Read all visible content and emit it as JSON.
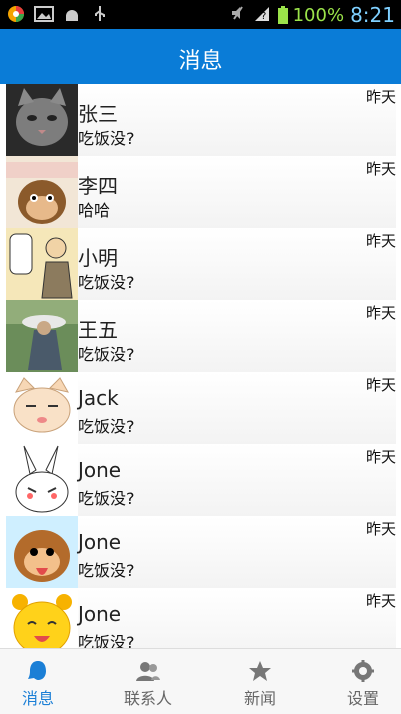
{
  "status": {
    "battery_text": "100%",
    "time": "8:21"
  },
  "header": {
    "title": "消息"
  },
  "messages": [
    {
      "name": "张三",
      "preview": "吃饭没?",
      "time": "昨天",
      "avatar": "cat-photo"
    },
    {
      "name": "李四",
      "preview": "哈哈",
      "time": "昨天",
      "avatar": "monkey-cartoon"
    },
    {
      "name": "小明",
      "preview": "吃饭没?",
      "time": "昨天",
      "avatar": "comic-character"
    },
    {
      "name": "王五",
      "preview": "吃饭没?",
      "time": "昨天",
      "avatar": "person-photo"
    },
    {
      "name": "Jack",
      "preview": "吃饭没?",
      "time": "昨天",
      "avatar": "cat-cartoon"
    },
    {
      "name": "Jone",
      "preview": "吃饭没?",
      "time": "昨天",
      "avatar": "rabbit-cartoon"
    },
    {
      "name": "Jone",
      "preview": "吃饭没?",
      "time": "昨天",
      "avatar": "monkey-tongue-cartoon"
    },
    {
      "name": "Jone",
      "preview": "吃饭没?",
      "time": "昨天",
      "avatar": "yellow-bear-cartoon"
    }
  ],
  "tabs": [
    {
      "label": "消息",
      "icon": "chat-icon",
      "active": true
    },
    {
      "label": "联系人",
      "icon": "contacts-icon",
      "active": false
    },
    {
      "label": "新闻",
      "icon": "news-icon",
      "active": false
    },
    {
      "label": "设置",
      "icon": "settings-icon",
      "active": false
    }
  ],
  "colors": {
    "header": "#0a7cd7",
    "active_tab": "#1b7fd6"
  }
}
